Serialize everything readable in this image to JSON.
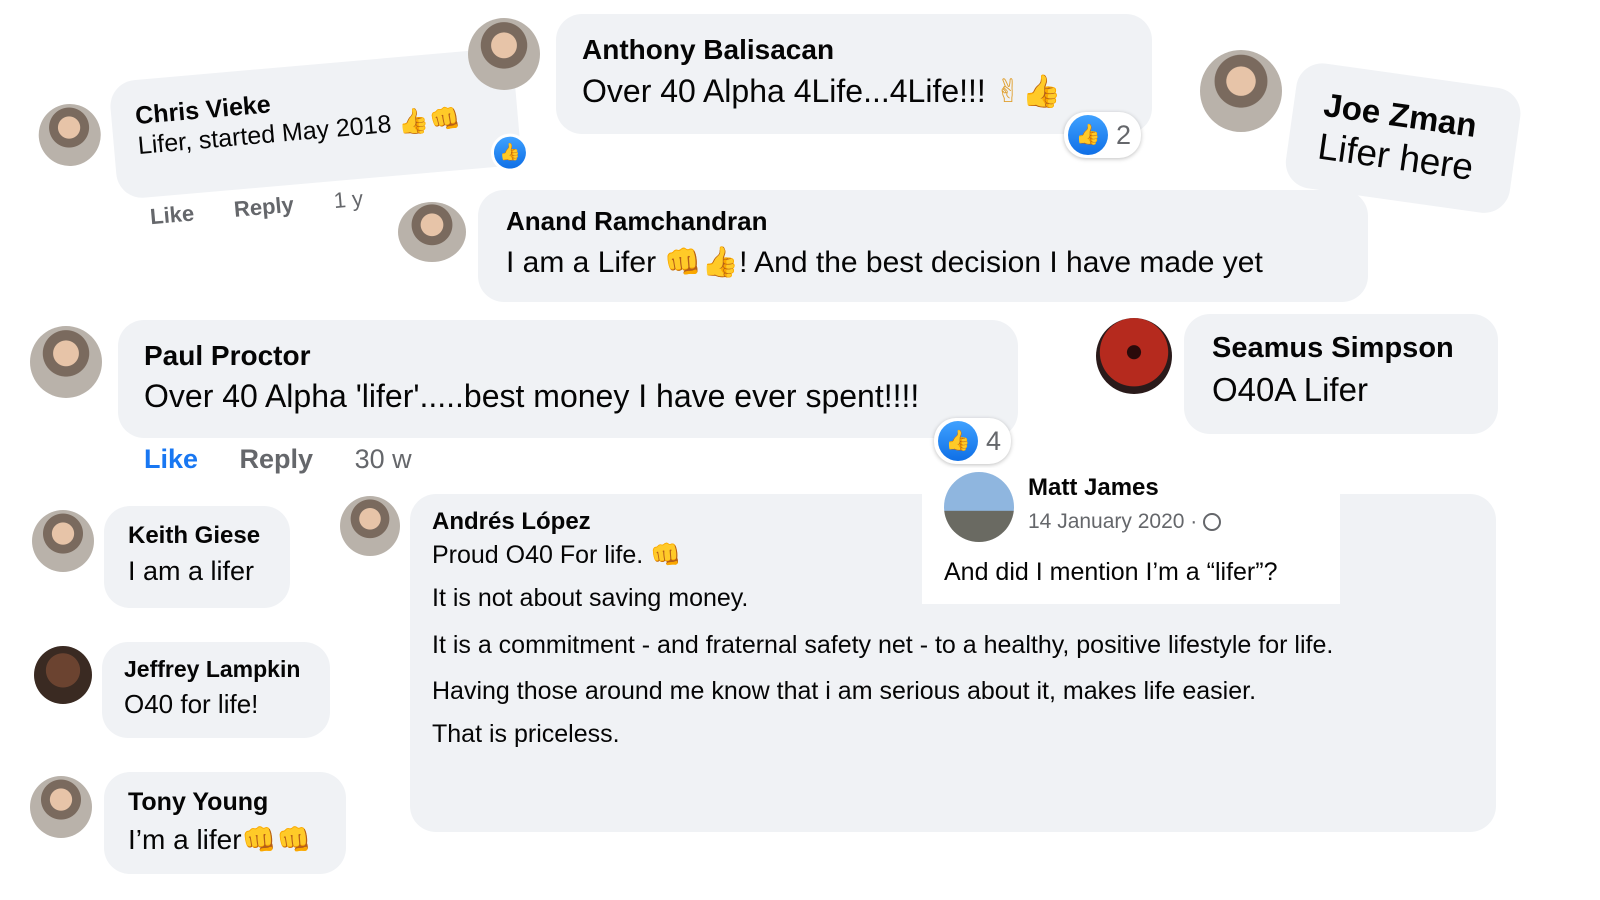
{
  "comments": {
    "chris": {
      "name": "Chris Vieke",
      "text": "Lifer, started May 2018",
      "actions": {
        "like": "Like",
        "reply": "Reply",
        "time": "1 y"
      }
    },
    "anthony": {
      "name": "Anthony Balisacan",
      "text": "Over 40 Alpha 4Life...4Life!!!",
      "reactions": "2"
    },
    "joe": {
      "name": "Joe Zman",
      "text": "Lifer here"
    },
    "anand": {
      "name": "Anand Ramchandran",
      "text_before": "I am a Lifer ",
      "text_after": "! And the best decision I have made yet"
    },
    "paul": {
      "name": "Paul Proctor",
      "text": "Over 40 Alpha 'lifer'.....best money I have ever spent!!!!",
      "reactions": "4",
      "actions": {
        "like": "Like",
        "reply": "Reply",
        "time": "30 w"
      }
    },
    "seamus": {
      "name": "Seamus Simpson",
      "text": "O40A Lifer"
    },
    "keith": {
      "name": "Keith Giese",
      "text": "I am a lifer"
    },
    "jeffrey": {
      "name": "Jeffrey Lampkin",
      "text": "O40 for life!"
    },
    "tony": {
      "name": "Tony Young",
      "text": "I’m a lifer"
    },
    "andres": {
      "name": "Andrés López",
      "line1": "Proud O40 For life.",
      "paragraphs": [
        "It is not about saving money.",
        "It is a commitment - and fraternal safety net - to a healthy, positive lifestyle for life.",
        "Having those around me know that i am serious about it, makes life easier.",
        "That is priceless."
      ]
    },
    "matt": {
      "name": "Matt James",
      "date": "14 January 2020 · ",
      "text": "And did I mention I’m a “lifer”?"
    }
  },
  "colors": {
    "bubble": "#f0f2f5",
    "like_blue": "#1877f2",
    "muted": "#65676b"
  },
  "icons": [
    "like-thumb-icon",
    "thumbs-up-emoji",
    "fist-bump-emoji",
    "victory-hand-emoji",
    "globe-icon"
  ]
}
